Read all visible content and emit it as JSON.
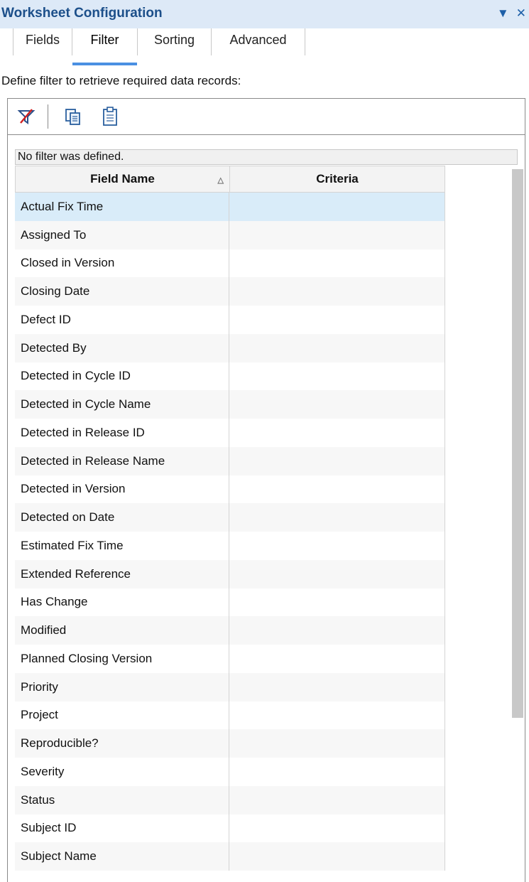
{
  "panel": {
    "title": "Worksheet Configuration",
    "icons": [
      "dropdown-arrow-icon",
      "close-icon"
    ]
  },
  "tabs": [
    {
      "label": "Fields",
      "active": false
    },
    {
      "label": "Filter",
      "active": true
    },
    {
      "label": "Sorting",
      "active": false
    },
    {
      "label": "Advanced",
      "active": false
    }
  ],
  "description": "Define filter to retrieve required data records:",
  "toolbar": {
    "icons": [
      "clear-filter-icon",
      "copy-icon",
      "paste-icon"
    ]
  },
  "filter_status": "No filter was defined.",
  "table": {
    "columns": [
      "Field Name",
      "Criteria"
    ],
    "sorted_column": "Field Name",
    "rows": [
      {
        "field": "Actual Fix Time",
        "criteria": ""
      },
      {
        "field": "Assigned To",
        "criteria": ""
      },
      {
        "field": "Closed in Version",
        "criteria": ""
      },
      {
        "field": "Closing Date",
        "criteria": ""
      },
      {
        "field": "Defect ID",
        "criteria": ""
      },
      {
        "field": "Detected By",
        "criteria": ""
      },
      {
        "field": "Detected in Cycle ID",
        "criteria": ""
      },
      {
        "field": "Detected in Cycle Name",
        "criteria": ""
      },
      {
        "field": "Detected in Release ID",
        "criteria": ""
      },
      {
        "field": "Detected in Release Name",
        "criteria": ""
      },
      {
        "field": "Detected in Version",
        "criteria": ""
      },
      {
        "field": "Detected on Date",
        "criteria": ""
      },
      {
        "field": "Estimated Fix Time",
        "criteria": ""
      },
      {
        "field": "Extended Reference",
        "criteria": ""
      },
      {
        "field": "Has Change",
        "criteria": ""
      },
      {
        "field": "Modified",
        "criteria": ""
      },
      {
        "field": "Planned Closing Version",
        "criteria": ""
      },
      {
        "field": "Priority",
        "criteria": ""
      },
      {
        "field": "Project",
        "criteria": ""
      },
      {
        "field": "Reproducible?",
        "criteria": ""
      },
      {
        "field": "Severity",
        "criteria": ""
      },
      {
        "field": "Status",
        "criteria": ""
      },
      {
        "field": "Subject ID",
        "criteria": ""
      },
      {
        "field": "Subject Name",
        "criteria": ""
      }
    ],
    "selected_row": 0
  },
  "colors": {
    "title_bar_bg": "#dde9f7",
    "title_text": "#1c4f8a",
    "active_tab_underline": "#4a90e2",
    "selected_row_bg": "#d9ecf9"
  }
}
